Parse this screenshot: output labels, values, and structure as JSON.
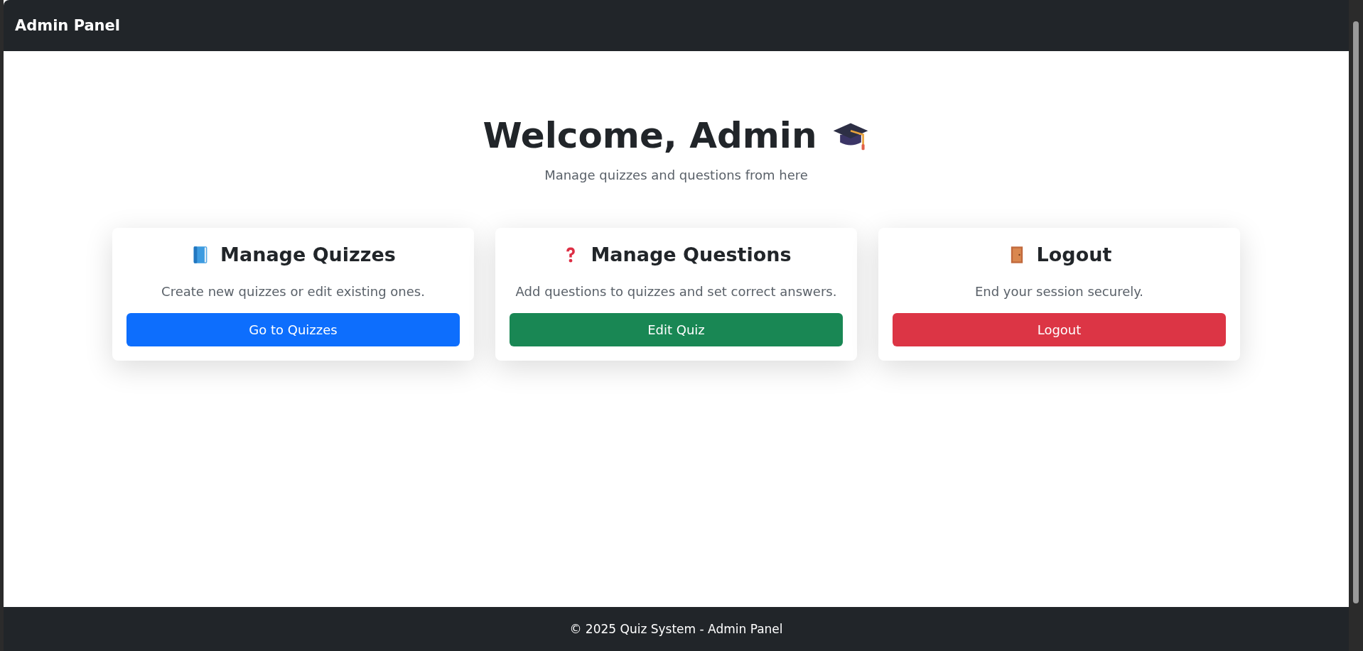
{
  "navbar": {
    "brand": "Admin Panel"
  },
  "header": {
    "title": "Welcome, Admin",
    "subtitle": "Manage quizzes and questions from here"
  },
  "cards": [
    {
      "kind": "book",
      "title": "Manage Quizzes",
      "text": "Create new quizzes or edit existing ones.",
      "button": {
        "label": "Go to Quizzes",
        "kind": "primary"
      }
    },
    {
      "kind": "question",
      "title": "Manage Questions",
      "text": "Add questions to quizzes and set correct answers.",
      "button": {
        "label": "Edit Quiz",
        "kind": "success"
      }
    },
    {
      "kind": "door",
      "title": "Logout",
      "text": "End your session securely.",
      "button": {
        "label": "Logout",
        "kind": "danger"
      }
    }
  ],
  "footer": {
    "text": "© 2025 Quiz System - Admin Panel"
  }
}
